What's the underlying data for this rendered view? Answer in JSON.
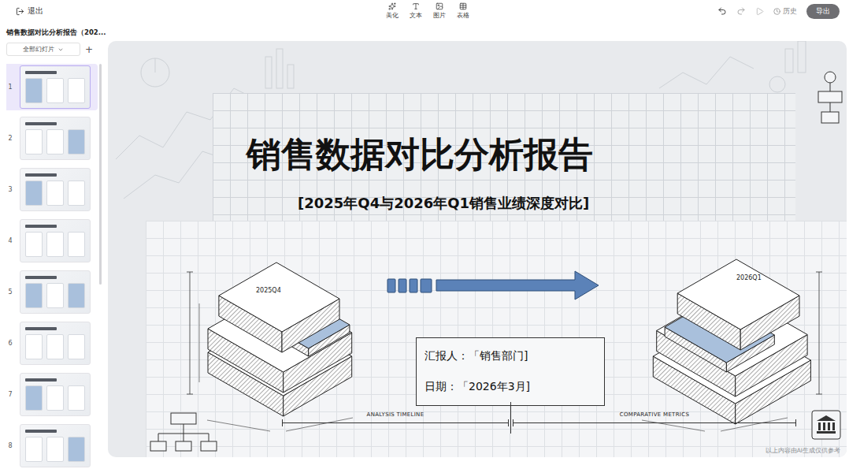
{
  "topbar": {
    "exit": "退出",
    "tools": [
      {
        "label": "美化"
      },
      {
        "label": "文本"
      },
      {
        "label": "图片"
      },
      {
        "label": "表格"
      }
    ],
    "history": "历史",
    "export": "导出"
  },
  "sidebar": {
    "title": "销售数据对比分析报告（202...",
    "view": "全部幻灯片",
    "add": "+",
    "slides": [
      {
        "number": "1",
        "selected": true
      },
      {
        "number": "2",
        "selected": false
      },
      {
        "number": "3",
        "selected": false
      },
      {
        "number": "4",
        "selected": false
      },
      {
        "number": "5",
        "selected": false
      },
      {
        "number": "6",
        "selected": false
      },
      {
        "number": "7",
        "selected": false
      },
      {
        "number": "8",
        "selected": false
      }
    ]
  },
  "slide": {
    "title": "销售数据对比分析报告",
    "subtitle": "[2025年Q4与2026年Q1销售业绩深度对比]",
    "reporter_label": "汇报人：",
    "reporter": "「销售部门]",
    "date_label": "日期：",
    "date": "「2026年3月]",
    "left_block": "2025Q4",
    "right_block": "2026Q1",
    "axis_left": "ANALYSIS TIMELINE",
    "axis_right": "COMPARATIVE METRICS",
    "footer": "以上内容由AI生成仅供参考"
  }
}
